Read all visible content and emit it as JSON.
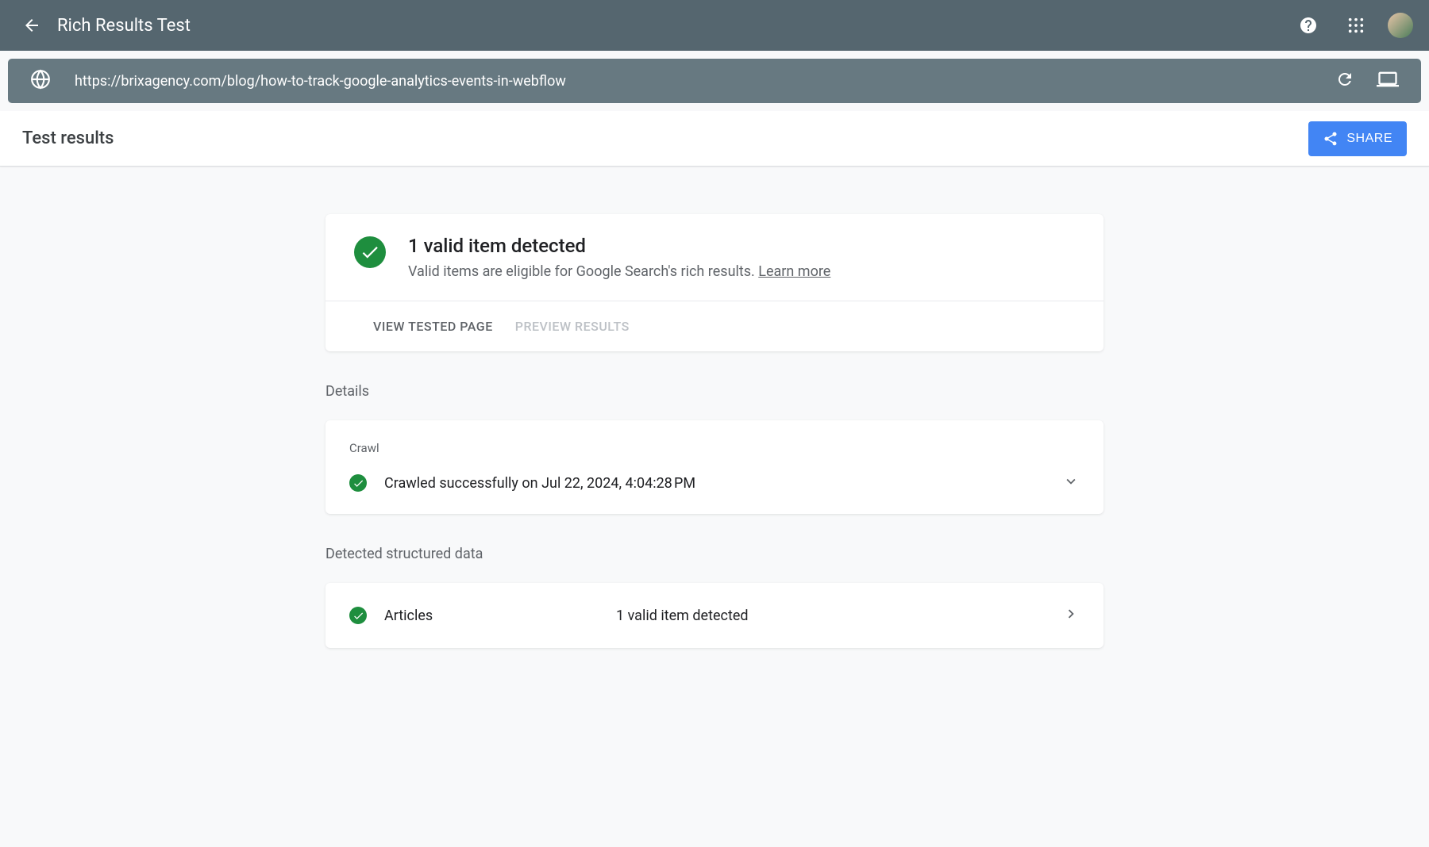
{
  "header": {
    "title": "Rich Results Test"
  },
  "url_bar": {
    "url": "https://brixagency.com/blog/how-to-track-google-analytics-events-in-webflow"
  },
  "subheader": {
    "title": "Test results",
    "share_label": "SHARE"
  },
  "summary": {
    "title": "1 valid item detected",
    "subtitle_prefix": "Valid items are eligible for Google Search's rich results. ",
    "learn_more": "Learn more",
    "view_tested_label": "VIEW TESTED PAGE",
    "preview_results_label": "PREVIEW RESULTS"
  },
  "details": {
    "section_label": "Details",
    "crawl_label": "Crawl",
    "crawl_text": "Crawled successfully on Jul 22, 2024, 4:04:28 PM"
  },
  "structured": {
    "section_label": "Detected structured data",
    "items": [
      {
        "name": "Articles",
        "status": "1 valid item detected"
      }
    ]
  }
}
